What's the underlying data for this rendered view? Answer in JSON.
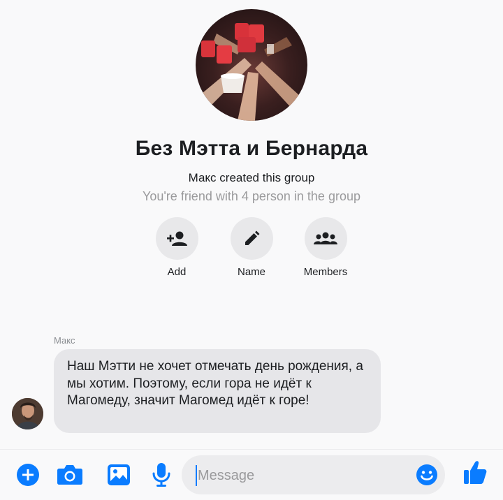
{
  "group": {
    "title": "Без Мэтта и Бернарда",
    "created_text": "Макс created this group",
    "friends_text": "You're friend with 4 person in the group"
  },
  "actions": [
    {
      "label": "Add",
      "icon": "add-person-icon"
    },
    {
      "label": "Name",
      "icon": "pencil-icon"
    },
    {
      "label": "Members",
      "icon": "group-members-icon"
    }
  ],
  "message": {
    "sender": "Макс",
    "text": "Наш Мэтти не хочет отмечать день рождения, а мы хотим. Поэтому, если гора не идёт к Магомеду, значит Магомед идёт к горе!"
  },
  "composer": {
    "placeholder": "Message",
    "icons": [
      "plus-circle-icon",
      "camera-icon",
      "image-icon",
      "microphone-icon",
      "emoji-icon",
      "thumbs-up-icon"
    ]
  },
  "colors": {
    "accent": "#0a7cff",
    "background": "#f9f9fa",
    "bubble": "#e6e6e9"
  }
}
